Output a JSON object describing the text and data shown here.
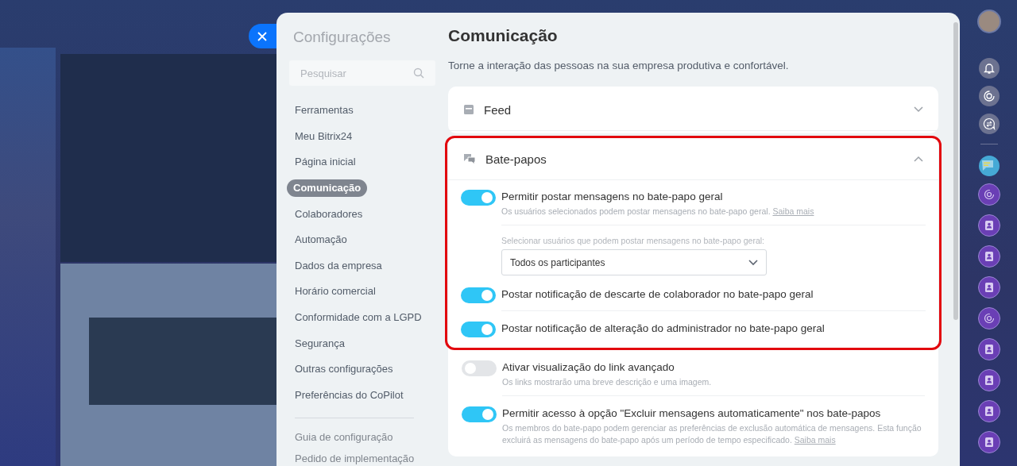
{
  "sidebar": {
    "title": "Configurações",
    "search": {
      "placeholder": "Pesquisar"
    },
    "items": [
      {
        "label": "Ferramentas",
        "selected": false
      },
      {
        "label": "Meu Bitrix24",
        "selected": false
      },
      {
        "label": "Página inicial",
        "selected": false
      },
      {
        "label": "Comunicação",
        "selected": true
      },
      {
        "label": "Colaboradores",
        "selected": false
      },
      {
        "label": "Automação",
        "selected": false
      },
      {
        "label": "Dados da empresa",
        "selected": false
      },
      {
        "label": "Horário comercial",
        "selected": false
      },
      {
        "label": "Conformidade com a LGPD",
        "selected": false
      },
      {
        "label": "Segurança",
        "selected": false
      },
      {
        "label": "Outras configurações",
        "selected": false
      },
      {
        "label": "Preferências do CoPilot",
        "selected": false
      }
    ],
    "footer_links": [
      "Guia de configuração",
      "Pedido de implementação"
    ]
  },
  "page": {
    "title": "Comunicação",
    "subtitle": "Torne a interação das pessoas na sua empresa produtiva e confortável."
  },
  "sections": [
    {
      "kind": "feed",
      "title": "Feed",
      "expanded": false,
      "highlighted": false
    },
    {
      "kind": "chat",
      "title": "Bate-papos",
      "expanded": true,
      "highlighted": true,
      "settings": [
        {
          "kind": "toggle",
          "label": "Permitir postar mensagens no bate-papo geral",
          "on": true,
          "highlighted": true,
          "description": "Os usuários selecionados podem postar mensagens no bate-papo geral.",
          "link": "Saiba mais"
        },
        {
          "kind": "select",
          "label": "Selecionar usuários que podem postar mensagens no bate-papo geral:",
          "value": "Todos os participantes",
          "highlighted": true
        },
        {
          "kind": "toggle",
          "label": "Postar notificação de descarte de colaborador no bate-papo geral",
          "on": true,
          "highlighted": true
        },
        {
          "kind": "toggle",
          "label": "Postar notificação de alteração do administrador no bate-papo geral",
          "on": true,
          "highlighted": true
        },
        {
          "kind": "toggle",
          "label": "Ativar visualização do link avançado",
          "on": false,
          "highlighted": false,
          "description": "Os links mostrarão uma breve descrição e uma imagem."
        },
        {
          "kind": "toggle",
          "label": "Permitir acesso à opção \"Excluir mensagens automaticamente\" nos bate-papos",
          "on": true,
          "highlighted": false,
          "description": "Os membros do bate-papo podem gerenciar as preferências de exclusão automática de mensagens. Esta função excluirá as mensagens do bate-papo após um período de tempo especificado.",
          "link": "Saiba mais"
        }
      ]
    }
  ],
  "right_bar": {
    "items": [
      {
        "kind": "avatar"
      },
      {
        "kind": "bell"
      },
      {
        "kind": "swirl"
      },
      {
        "kind": "chat-arrows"
      },
      {
        "kind": "divider"
      },
      {
        "kind": "messages"
      },
      {
        "kind": "globe"
      },
      {
        "kind": "contact"
      },
      {
        "kind": "contact"
      },
      {
        "kind": "contact"
      },
      {
        "kind": "globe"
      },
      {
        "kind": "contact"
      },
      {
        "kind": "contact"
      },
      {
        "kind": "contact"
      },
      {
        "kind": "contact"
      }
    ]
  }
}
